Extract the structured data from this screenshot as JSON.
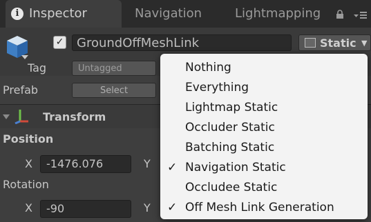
{
  "tabs": [
    {
      "label": "Inspector",
      "icon": "info-icon"
    },
    {
      "label": "Navigation"
    },
    {
      "label": "Lightmapping"
    }
  ],
  "header": {
    "enabled_check": "✓",
    "object_name": "GroundOffMeshLink",
    "static_label": "Static",
    "tag_label": "Tag",
    "tag_value": "Untagged",
    "prefab_label": "Prefab",
    "prefab_select": "Select"
  },
  "transform": {
    "title": "Transform",
    "position_label": "Position",
    "position_x_label": "X",
    "position_x_value": "-1476.076",
    "position_y_label": "Y",
    "rotation_label": "Rotation",
    "rotation_x_label": "X",
    "rotation_x_value": "-90",
    "rotation_y_label": "Y"
  },
  "static_menu": {
    "items": [
      {
        "label": "Nothing",
        "checked": false
      },
      {
        "label": "Everything",
        "checked": false
      },
      {
        "label": "Lightmap Static",
        "checked": false
      },
      {
        "label": "Occluder Static",
        "checked": false
      },
      {
        "label": "Batching Static",
        "checked": false
      },
      {
        "label": "Navigation Static",
        "checked": true
      },
      {
        "label": "Occludee Static",
        "checked": false
      },
      {
        "label": "Off Mesh Link Generation",
        "checked": true
      }
    ],
    "check_glyph": "✓"
  },
  "colors": {
    "panel": "#3e3e3e",
    "tab_bar": "#2b2b2b",
    "transform_axis_red": "#d04a3a",
    "transform_axis_green": "#6fc04a",
    "transform_axis_blue": "#4a7fd0",
    "menu_bg": "#f3f3f3"
  }
}
